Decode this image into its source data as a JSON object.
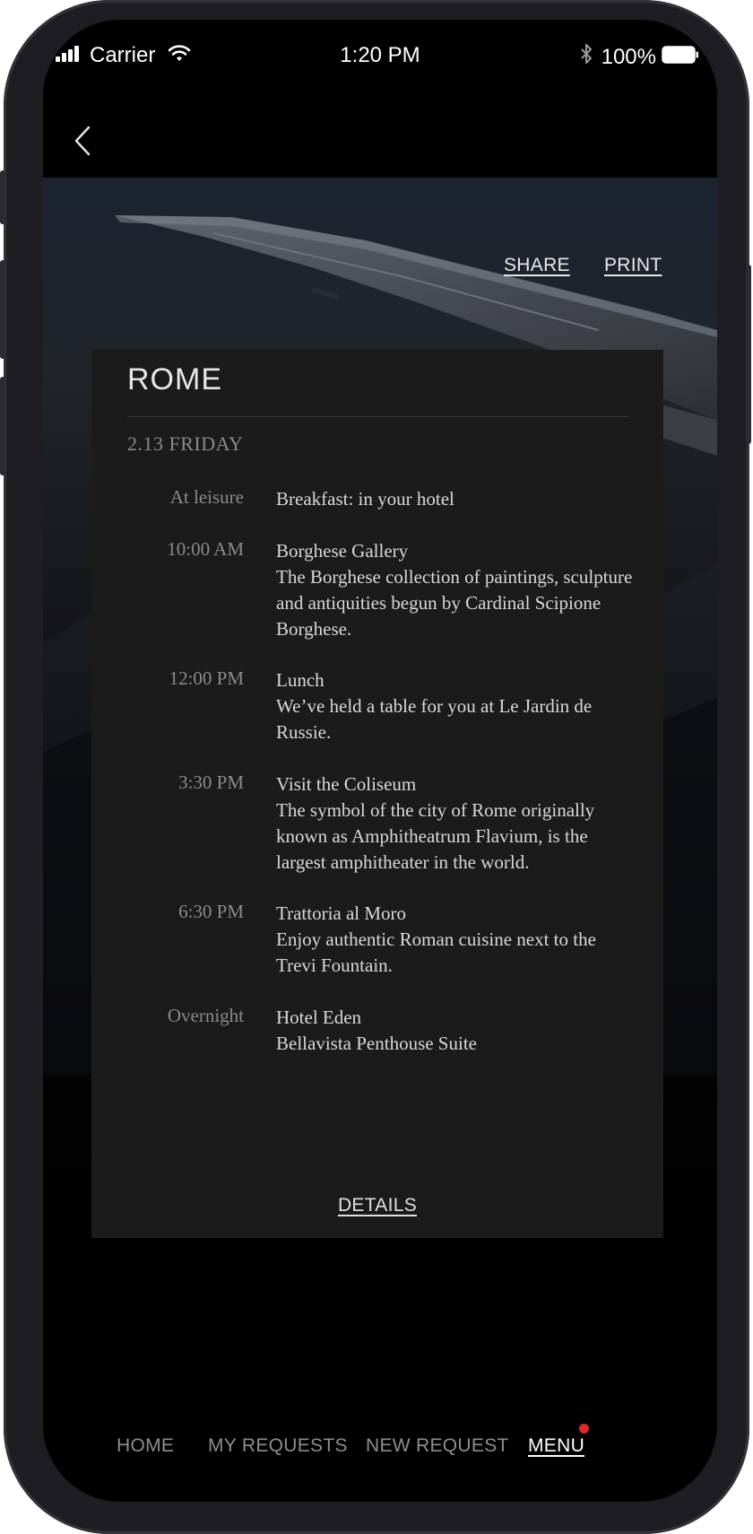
{
  "status_bar": {
    "carrier": "Carrier",
    "time": "1:20 PM",
    "battery": "100%"
  },
  "actions": {
    "share": "SHARE",
    "print": "PRINT"
  },
  "card": {
    "city": "ROME",
    "date": "2.13 FRIDAY",
    "items": [
      {
        "time": "At leisure",
        "title": "Breakfast: in your hotel",
        "description": ""
      },
      {
        "time": "10:00 AM",
        "title": "Borghese Gallery",
        "description": "The Borghese collection of paintings, sculpture and antiquities begun by Cardinal Scipione Borghese."
      },
      {
        "time": "12:00 PM",
        "title": "Lunch",
        "description": "We’ve held a table for you at Le Jardin de Russie."
      },
      {
        "time": "3:30 PM",
        "title": "Visit the Coliseum",
        "description": "The symbol of the city of Rome originally known as Amphitheatrum Flavium, is the largest amphitheater in the world."
      },
      {
        "time": "6:30 PM",
        "title": "Trattoria al Moro",
        "description": "Enjoy authentic Roman cuisine next to the Trevi Fountain."
      },
      {
        "time": "Overnight",
        "title": "Hotel Eden",
        "description": "Bellavista Penthouse Suite"
      }
    ],
    "details": "DETAILS"
  },
  "nav": {
    "home": "HOME",
    "my_requests": "MY REQUESTS",
    "new_request": "NEW REQUEST",
    "menu": "MENU",
    "active": "menu"
  },
  "colors": {
    "badge": "#e3262b",
    "card_bg": "#1b1b1b",
    "screen_bg": "#000000"
  },
  "icons": {
    "back": "chevron-left-icon",
    "signal": "cellular-signal-icon",
    "wifi": "wifi-icon",
    "bluetooth": "bluetooth-icon",
    "battery": "battery-icon"
  }
}
